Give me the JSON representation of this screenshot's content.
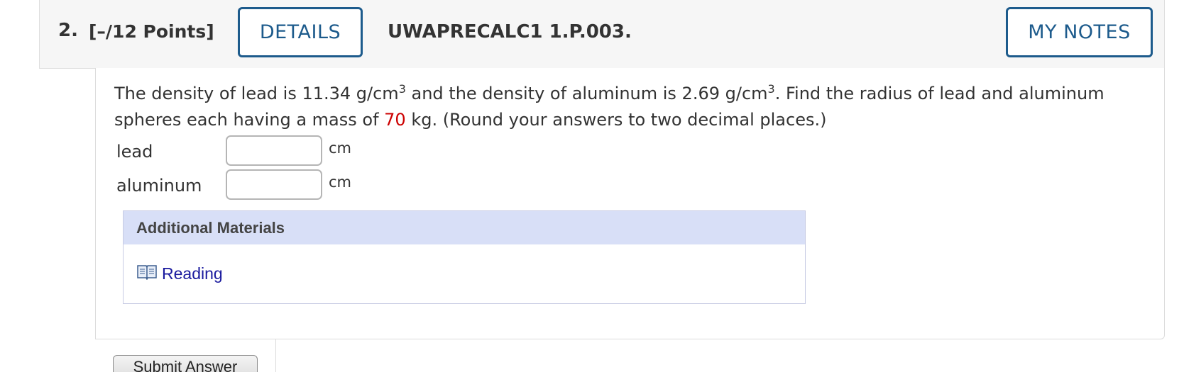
{
  "header": {
    "number": "2.",
    "points": "[–/12 Points]",
    "details_label": "DETAILS",
    "problem_code": "UWAPRECALC1 1.P.003.",
    "notes_label": "MY NOTES"
  },
  "prompt": {
    "part1": "The density of lead is 11.34 g/cm",
    "sup1": "3",
    "part2": " and the density of aluminum is 2.69 g/cm",
    "sup2": "3",
    "part3": ". Find the radius of lead and aluminum spheres each having a mass of ",
    "mass": "70",
    "part4": " kg. (Round your answers to two decimal places.)"
  },
  "answers": [
    {
      "label": "lead",
      "value": "",
      "unit": "cm"
    },
    {
      "label": "aluminum",
      "value": "",
      "unit": "cm"
    }
  ],
  "materials": {
    "title": "Additional Materials",
    "link_icon": "book-icon",
    "link_label": "Reading"
  },
  "submit_label": "Submit Answer",
  "colors": {
    "accent": "#1d5b8c",
    "highlight": "#cc0000",
    "materials_header": "#d8dff7",
    "link": "#1a1a9e"
  }
}
